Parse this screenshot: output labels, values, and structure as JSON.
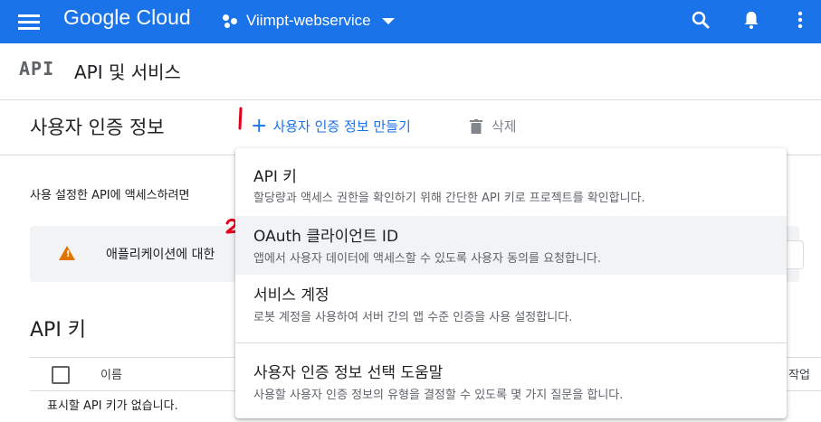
{
  "header": {
    "logo_text": "Google Cloud",
    "project_name": "Viimpt-webservice"
  },
  "subheader": {
    "api_logo": "API",
    "title": "API 및 서비스"
  },
  "toolbar": {
    "page_title": "사용자 인증 정보",
    "create_label": "사용자 인증 정보 만들기",
    "delete_label": "삭제"
  },
  "main": {
    "description": "사용 설정한 API에 액세스하려면",
    "warning_text": "애플리케이션에 대한",
    "api_keys_heading": "API 키",
    "table": {
      "columns": [
        "이름",
        "작업"
      ],
      "empty_text": "표시할 API 키가 없습니다."
    }
  },
  "dropdown": {
    "items": [
      {
        "title": "API 키",
        "subtitle": "할당량과 액세스 권한을 확인하기 위해 간단한 API 키로 프로젝트를 확인합니다."
      },
      {
        "title": "OAuth 클라이언트 ID",
        "subtitle": "앱에서 사용자 데이터에 액세스할 수 있도록 사용자 동의를 요청합니다."
      },
      {
        "title": "서비스 계정",
        "subtitle": "로봇 계정을 사용하여 서버 간의 앱 수준 인증을 사용 설정합니다."
      },
      {
        "title": "사용자 인증 정보 선택 도움말",
        "subtitle": "사용할 사용자 인증 정보의 유형을 결정할 수 있도록 몇 가지 질문을 합니다."
      }
    ]
  },
  "annotations": {
    "mark1": "1",
    "mark2": "2"
  },
  "colors": {
    "brand": "#1a73e8",
    "warning": "#e37400",
    "annotation": "#e5001a"
  },
  "icons": [
    "hamburger-menu-icon",
    "project-icon",
    "chevron-down-icon",
    "search-icon",
    "notifications-icon",
    "more-vert-icon",
    "plus-icon",
    "trash-icon",
    "warning-icon"
  ]
}
